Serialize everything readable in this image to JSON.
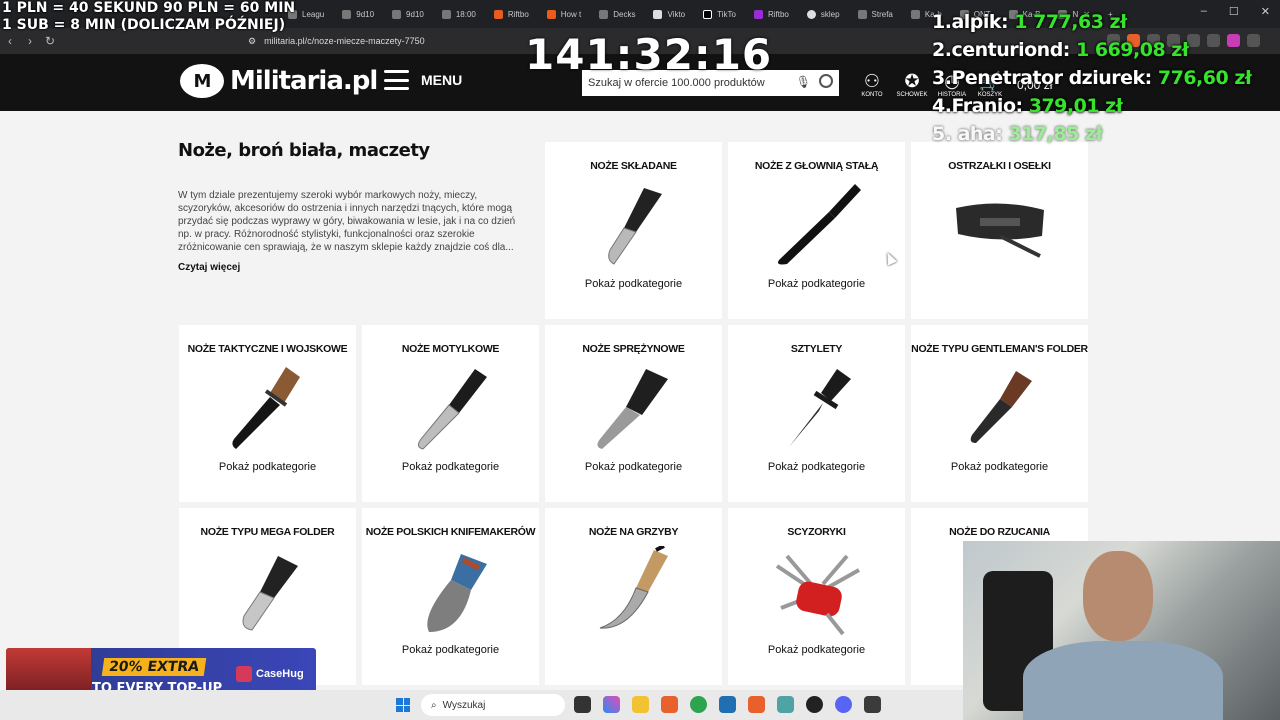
{
  "browser": {
    "tabs": [
      "Leagu",
      "9d10",
      "9d10",
      "18:00",
      "Riftbo",
      "How t",
      "Decks",
      "Vikto",
      "TikTo",
      "Riftbo",
      "sklep",
      "Strefa",
      "Ka-b",
      "ONT",
      "Ka-B",
      "N"
    ],
    "url": "militaria.pl/c/noze-miecze-maczety-7750"
  },
  "header": {
    "logo_text": "Militaria.pl",
    "logo_badge": "M",
    "menu_label": "MENU",
    "search_placeholder": "Szukaj w ofercie 100.000 produktów",
    "icons": [
      {
        "label": "KONTO",
        "glyph": "account-icon"
      },
      {
        "label": "SCHOWEK",
        "glyph": "star-icon"
      },
      {
        "label": "HISTORIA",
        "glyph": "history-icon"
      },
      {
        "label": "KOSZYK",
        "glyph": "cart-icon"
      }
    ],
    "cart_total": "0,00 zł"
  },
  "intro": {
    "title": "Noże, broń biała, maczety",
    "text": "W tym dziale prezentujemy szeroki wybór markowych noży, mieczy, scyzoryków, akcesoriów do ostrzenia i innych narzędzi tnących, które mogą przydać się podczas wyprawy w góry, biwakowania w lesie, jak i na co dzień np. w pracy. Różnorodność stylistyki, funkcjonalności oraz szerokie zróżnicowanie cen sprawiają, że w naszym sklepie każdy znajdzie coś dla...",
    "read_more": "Czytaj więcej"
  },
  "categories": [
    {
      "title": "NOŻE SKŁADANE",
      "more": "Pokaż podkategorie"
    },
    {
      "title": "NOŻE Z GŁOWNIĄ STAŁĄ",
      "more": "Pokaż podkategorie"
    },
    {
      "title": "OSTRZAŁKI I OSEŁKI",
      "more": ""
    },
    {
      "title": "NOŻE TAKTYCZNE I WOJSKOWE",
      "more": "Pokaż podkategorie"
    },
    {
      "title": "NOŻE MOTYLKOWE",
      "more": "Pokaż podkategorie"
    },
    {
      "title": "NOŻE SPRĘŻYNOWE",
      "more": "Pokaż podkategorie"
    },
    {
      "title": "SZTYLETY",
      "more": "Pokaż podkategorie"
    },
    {
      "title": "NOŻE TYPU GENTLEMAN'S FOLDER",
      "more": "Pokaż podkategorie"
    },
    {
      "title": "NOŻE TYPU MEGA FOLDER",
      "more": ""
    },
    {
      "title": "NOŻE POLSKICH KNIFEMAKERÓW",
      "more": "Pokaż podkategorie"
    },
    {
      "title": "NOŻE NA GRZYBY",
      "more": ""
    },
    {
      "title": "SCYZORYKI",
      "more": "Pokaż podkategorie"
    },
    {
      "title": "NOŻE DO RZUCANIA",
      "more": ""
    }
  ],
  "overlay": {
    "rates_line1": "1 PLN =  40 SEKUND 90 PLN = 60 MIN",
    "rates_line2": "1 SUB = 8 MIN (DOLICZAM PÓŹNIEJ)",
    "timer": "141:32:16",
    "leaderboard": [
      {
        "rank": "1.",
        "name": "alpik:",
        "amount": "1 777,63 zł"
      },
      {
        "rank": "2.",
        "name": "centuriond:",
        "amount": "1 669,08 zł"
      },
      {
        "rank": "3.",
        "name": "Penetrator dziurek:",
        "amount": "776,60 zł"
      },
      {
        "rank": "4.",
        "name": "Franio:",
        "amount": "379,01 zł"
      },
      {
        "rank": "5.",
        "name": "aha:",
        "amount": "317,85 zł"
      }
    ]
  },
  "ad": {
    "line1": "20% EXTRA",
    "line2": "TO EVERY TOP-UP",
    "brand": "CaseHug"
  },
  "taskbar": {
    "search_placeholder": "Wyszukaj"
  }
}
